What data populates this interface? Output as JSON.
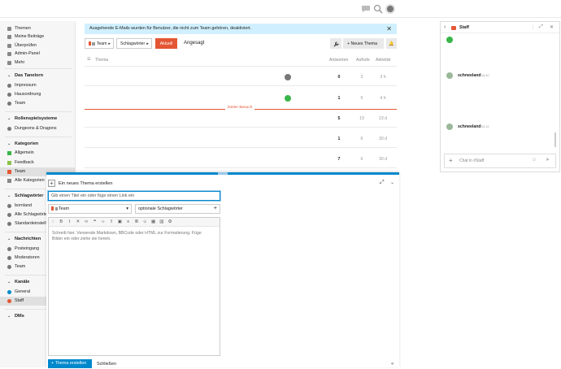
{
  "header": {
    "icons": [
      "chat-icon",
      "search-icon",
      "avatar"
    ]
  },
  "sidebar": {
    "top_items": [
      {
        "label": "Themen",
        "icon": "topics-icon"
      },
      {
        "label": "Meine Beiträge",
        "icon": "user-icon"
      },
      {
        "label": "Überprüfen",
        "icon": "review-icon"
      },
      {
        "label": "Admin-Panel",
        "icon": "wrench-icon"
      },
      {
        "label": "Mehr",
        "icon": "more-icon"
      }
    ],
    "sections": [
      {
        "title": "Das Tanelorn",
        "items": [
          "Impressum",
          "Hausordnung",
          "Team"
        ]
      },
      {
        "title": "Rollenspielsysteme",
        "items": [
          "Dungeons & Dragons"
        ]
      },
      {
        "title": "Kategorien",
        "items": [
          "Allgemein",
          "Feedback",
          "Team",
          "Alle Kategorien"
        ]
      },
      {
        "title": "Schlagwörter",
        "items": [
          "bornland",
          "Alle Schlagwörter",
          "Standardeinstellungen"
        ]
      },
      {
        "title": "Nachrichten",
        "items": [
          "Posteingang",
          "Moderatoren",
          "Team"
        ]
      },
      {
        "title": "Kanäle",
        "items": [
          "General",
          "Staff"
        ]
      },
      {
        "title": "DMs",
        "items": []
      }
    ]
  },
  "banner": {
    "text": "Ausgehende E-Mails wurden für Benutzer, die nicht zum Team gehören, deaktiviert.",
    "close": "✕"
  },
  "toolbar": {
    "category": "Team",
    "tags": "Schlagwörter",
    "tab_latest": "Aktuell",
    "tab_hot": "Angesagt",
    "new_topic": "Neues Thema"
  },
  "table": {
    "headers": {
      "topic": "Thema",
      "replies": "Antworten",
      "views": "Aufrufe",
      "activity": "Aktivität"
    },
    "rows": [
      {
        "replies": "0",
        "views": "3",
        "activity": "3 h",
        "avatar": "grey"
      },
      {
        "replies": "1",
        "views": "5",
        "activity": "4 h",
        "avatar": "green"
      },
      {
        "replies": "5",
        "views": "19",
        "activity": "23 d",
        "avatar": ""
      },
      {
        "replies": "1",
        "views": "6",
        "activity": "30 d",
        "avatar": ""
      },
      {
        "replies": "7",
        "views": "6",
        "activity": "30 d",
        "avatar": ""
      }
    ],
    "last_visit": "letzter Besuch"
  },
  "chat": {
    "channel": "Staff",
    "messages": [
      {
        "user": "schneeland",
        "time": "16:40"
      },
      {
        "user": "schneeland",
        "time": "02:12"
      }
    ],
    "input_placeholder": "Chat in #Staff"
  },
  "composer": {
    "action": "Ein neues Thema erstellen",
    "title_placeholder": "Gib einen Titel ein oder füge einen Link ein",
    "category": "Team",
    "tags_placeholder": "optionale Schlagwörter",
    "body_placeholder": "Schreib hier. Verwende Markdown, BBCode oder HTML zur Formatierung. Füge Bilder ein oder ziehe sie herein.",
    "submit": "Thema erstellen",
    "close": "Schließen"
  },
  "colors": {
    "accent": "#0088cc",
    "danger": "#e45735",
    "banner": "#d1f0ff",
    "team_category": "#e45735",
    "green_category": "#3ab54a"
  }
}
